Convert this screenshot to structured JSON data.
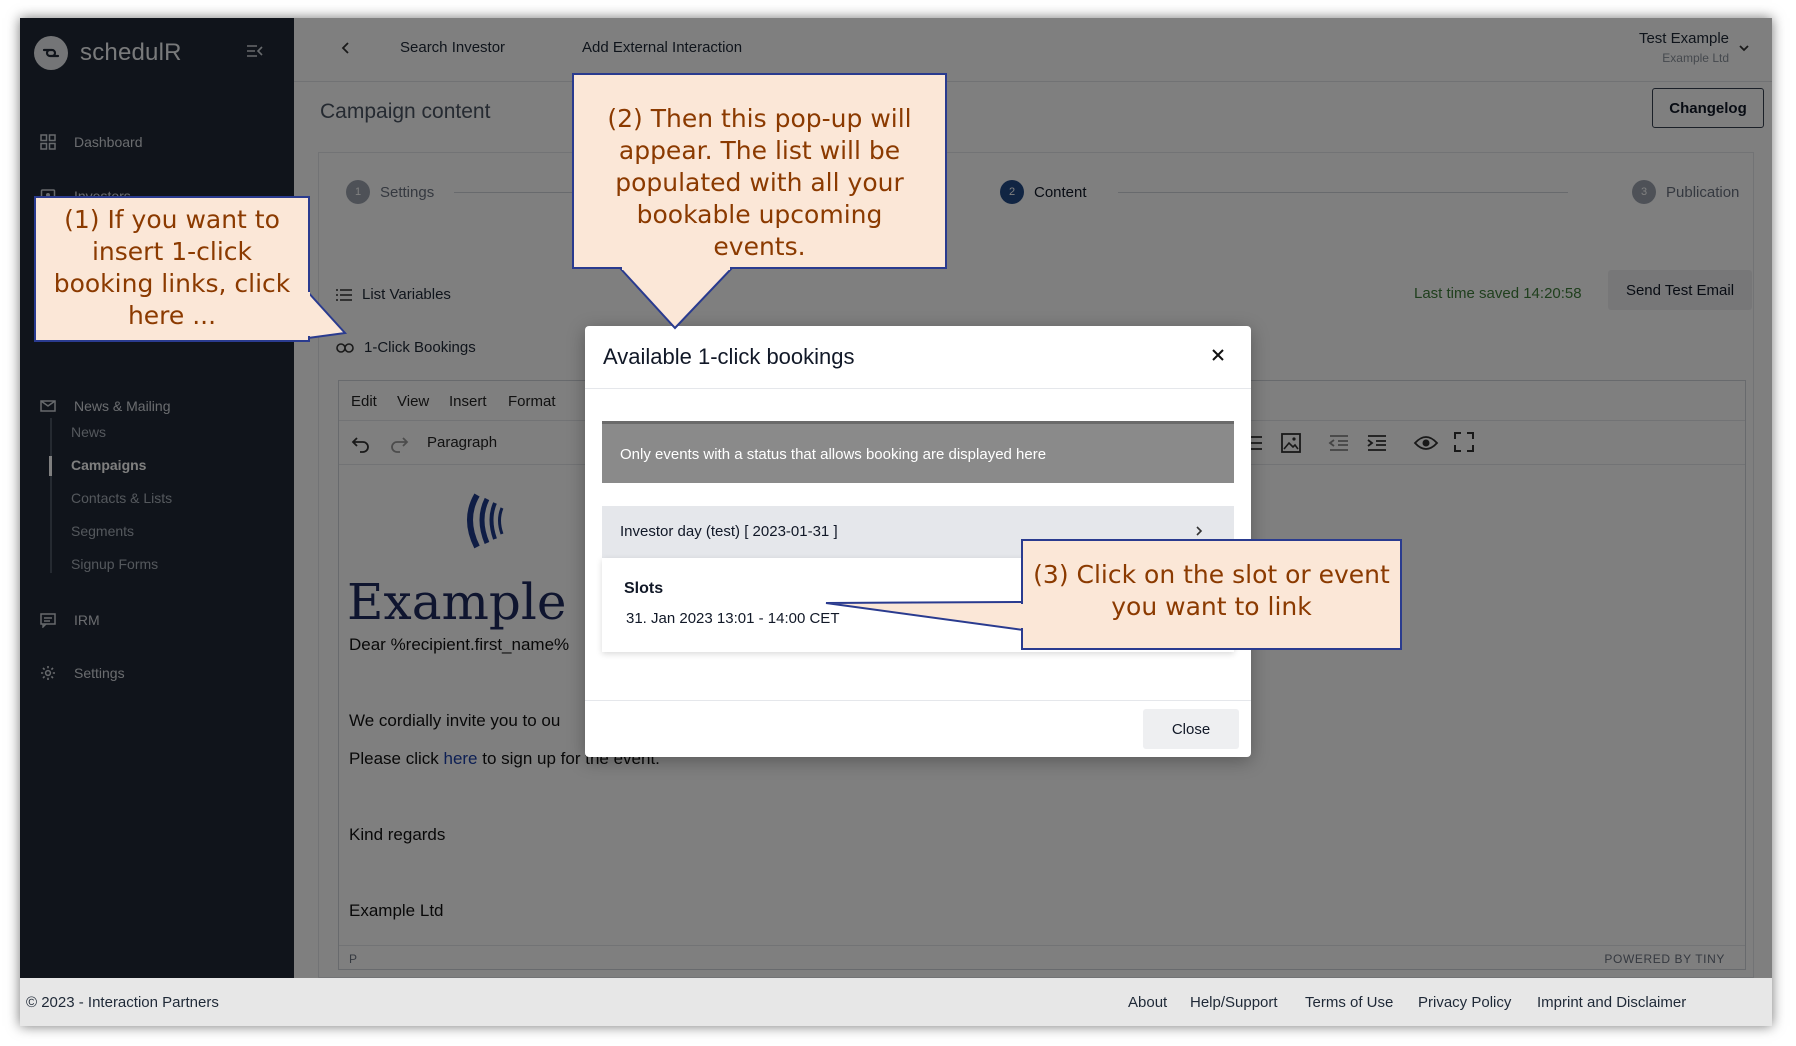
{
  "app": {
    "name": "schedulR"
  },
  "sidebar": {
    "items": [
      {
        "label": "Dashboard",
        "icon": "dashboard-icon"
      },
      {
        "label": "Investors",
        "icon": "investors-icon"
      },
      {
        "label": "News & Mailing",
        "icon": "mail-icon"
      },
      {
        "label": "IRM",
        "icon": "irm-icon"
      },
      {
        "label": "Settings",
        "icon": "gear-icon"
      }
    ],
    "subitems": [
      "News",
      "Campaigns",
      "Contacts & Lists",
      "Segments",
      "Signup Forms"
    ],
    "active_subitem": "Campaigns"
  },
  "topbar": {
    "links": [
      "Search Investor",
      "Add External Interaction"
    ],
    "user_name": "Test Example",
    "user_org": "Example Ltd"
  },
  "page": {
    "title": "Campaign content",
    "changelog_label": "Changelog",
    "steps": [
      {
        "num": "1",
        "label": "Settings"
      },
      {
        "num": "2",
        "label": "Content"
      },
      {
        "num": "3",
        "label": "Publication"
      }
    ],
    "active_step": "Content",
    "list_variables_label": "List Variables",
    "bookings_label": "1-Click Bookings",
    "last_saved": "Last time saved 14:20:58",
    "send_test_label": "Send Test Email"
  },
  "editor": {
    "menu": [
      "Edit",
      "View",
      "Insert",
      "Format"
    ],
    "block_format": "Paragraph",
    "heading": "Example I",
    "greeting": "Dear %recipient.first_name%",
    "line1": "We cordially invite you to ou",
    "line2_before": "Please click ",
    "line2_link": "here",
    "line2_after": " to sign up for the event.",
    "regards": "Kind regards",
    "signature": "Example Ltd",
    "status_path": "P",
    "powered": "POWERED BY TINY"
  },
  "modal": {
    "title": "Available 1-click bookings",
    "notice": "Only events with a status that allows booking are displayed here",
    "event": "Investor day (test) [ 2023-01-31 ]",
    "slots_title": "Slots",
    "slot": "31. Jan 2023 13:01 - 14:00 CET",
    "close_label": "Close"
  },
  "callouts": {
    "c1": "(1) If you want to insert 1-click booking links, click here ...",
    "c2": "(2) Then this pop-up will appear. The list will be populated with all your bookable upcoming events.",
    "c3": "(3) Click on the slot or event you want to link"
  },
  "footer": {
    "copyright": "© 2023 - Interaction Partners",
    "links": [
      "About",
      "Help/Support",
      "Terms of Use",
      "Privacy Policy",
      "Imprint and Disclaimer"
    ]
  },
  "colors": {
    "sidebar_bg": "#212936",
    "accent": "#234a86",
    "callout_bg": "#fbe7d7",
    "callout_border": "#2a3b8f",
    "callout_text": "#8b3a00",
    "saved_green": "#3f7f3a"
  }
}
